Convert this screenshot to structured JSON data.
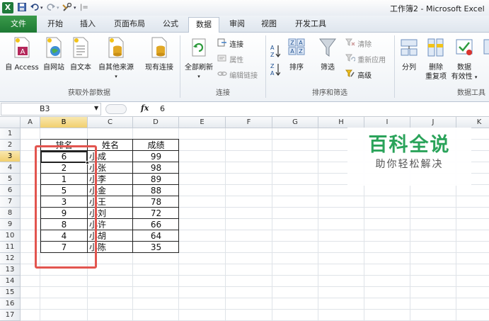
{
  "window": {
    "title": "工作簿2 - Microsoft Excel",
    "app_icon": "X",
    "qat": {
      "save": "save-icon",
      "undo": "undo-icon",
      "redo": "redo-icon",
      "custom": "tools-icon",
      "separator": "|="
    }
  },
  "tabs": [
    "文件",
    "开始",
    "插入",
    "页面布局",
    "公式",
    "数据",
    "审阅",
    "视图",
    "开发工具"
  ],
  "ribbon": {
    "get_external": {
      "from_access": "自 Access",
      "from_web": "自网站",
      "from_text": "自文本",
      "from_other": "自其他来源",
      "existing": "现有连接",
      "group_label": "获取外部数据"
    },
    "connections": {
      "refresh_all": "全部刷新",
      "connections": "连接",
      "properties": "属性",
      "edit_links": "编辑链接",
      "group_label": "连接"
    },
    "sort_filter": {
      "sort_asc": "A↓Z",
      "sort_desc": "Z↓A",
      "sort": "排序",
      "filter": "筛选",
      "clear": "清除",
      "reapply": "重新应用",
      "advanced": "高级",
      "group_label": "排序和筛选"
    },
    "data_tools": {
      "text_to_columns": "分列",
      "remove_duplicates_1": "删除",
      "remove_duplicates_2": "重复项",
      "validation_1": "数据",
      "validation_2": "有效性",
      "group_label": "数据工具"
    }
  },
  "formula_bar": {
    "name_box": "B3",
    "fx": "fx",
    "value": "6"
  },
  "grid": {
    "columns": [
      "A",
      "B",
      "C",
      "D",
      "E",
      "F",
      "G",
      "H",
      "I",
      "J",
      "K"
    ],
    "rows": [
      "1",
      "2",
      "3",
      "4",
      "5",
      "6",
      "7",
      "8",
      "9",
      "10",
      "11",
      "12",
      "13",
      "14",
      "15",
      "16",
      "17"
    ],
    "selected_col": "B",
    "selected_row": "3"
  },
  "table": {
    "headers": [
      "排名",
      "姓名",
      "成绩"
    ],
    "rows": [
      [
        "6",
        "小成",
        "99"
      ],
      [
        "2",
        "小张",
        "98"
      ],
      [
        "1",
        "小李",
        "89"
      ],
      [
        "5",
        "小金",
        "88"
      ],
      [
        "3",
        "小王",
        "78"
      ],
      [
        "9",
        "小刘",
        "72"
      ],
      [
        "8",
        "小许",
        "66"
      ],
      [
        "4",
        "小胡",
        "64"
      ],
      [
        "7",
        "小陈",
        "35"
      ]
    ]
  },
  "watermark": {
    "main": "百科全说",
    "sub": "助你轻松解决"
  },
  "colors": {
    "file_tab": "#1e7a34",
    "highlight_box": "#e2554f",
    "watermark": "#2aa35a",
    "selected_header": "#f1cf6e"
  }
}
